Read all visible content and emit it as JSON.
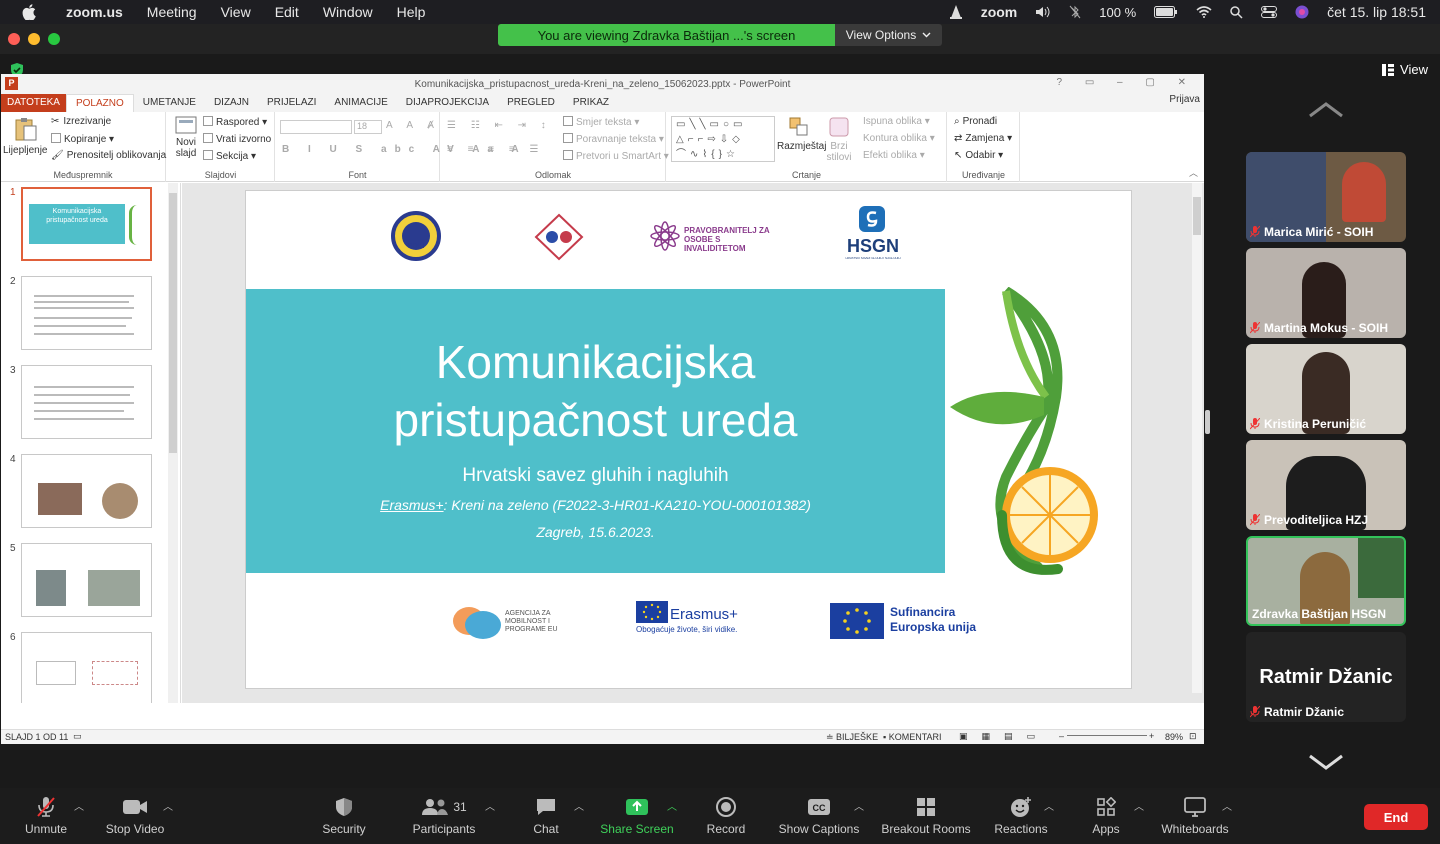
{
  "menubar": {
    "app": "zoom.us",
    "items": [
      "Meeting",
      "View",
      "Edit",
      "Window",
      "Help"
    ],
    "battery": "100 %",
    "clock": "čet 15. lip  18:51",
    "zoom_label": "zoom"
  },
  "zoom": {
    "viewing_banner": "You are viewing Zdravka Baštijan ...'s screen",
    "view_options": "View Options",
    "view_label": "View"
  },
  "ppt": {
    "title": "Komunikacijska_pristupacnost_ureda-Kreni_na_zeleno_15062023.pptx - PowerPoint",
    "tabs": [
      "DATOTEKA",
      "POLAZNO",
      "UMETANJE",
      "DIZAJN",
      "PRIJELAZI",
      "ANIMACIJE",
      "DIJAPROJEKCIJA",
      "PREGLED",
      "PRIKAZ"
    ],
    "signin": "Prijava",
    "ribbon": {
      "paste": "Lijepljenje",
      "cut": "Izrezivanje",
      "copy": "Kopiranje",
      "format_painter": "Prenositelj oblikovanja",
      "clipboard": "Međuspremnik",
      "new_slide": "Novi slajd",
      "layout": "Raspored",
      "reset": "Vrati izvorno",
      "section": "Sekcija",
      "slides": "Slajdovi",
      "font_size": "18",
      "font": "Font",
      "text_direction": "Smjer teksta",
      "align_text": "Poravnanje teksta",
      "smartart": "Pretvori u SmartArt",
      "paragraph": "Odlomak",
      "arrange": "Razmještaj",
      "quick_styles": "Brzi stilovi",
      "shape_fill": "Ispuna oblika",
      "shape_outline": "Kontura oblika",
      "shape_effects": "Efekti oblika",
      "drawing": "Crtanje",
      "find": "Pronađi",
      "replace": "Zamjena",
      "select": "Odabir",
      "editing": "Uređivanje"
    },
    "slide": {
      "title_line1": "Komunikacijska",
      "title_line2": "pristupačnost ureda",
      "subtitle": "Hrvatski savez gluhih i nagluhih",
      "project_prefix": "Erasmus+",
      "project_rest": ": Kreni na zeleno (F2022-3-HR01-KA210-YOU-000101382)",
      "date": "Zagreb, 15.6.2023.",
      "logo_soih": "SOIH",
      "logo_pravobranitelj": "PRAVOBRANITELJ ZA OSOBE S INVALIDITETOM",
      "logo_hsgn": "HSGN",
      "logo_hsgn_sub": "HRVATSKI SAVEZ GLUHIH I NAGLUHIH",
      "logo_agencija": "AGENCIJA ZA MOBILNOST I PROGRAME EU",
      "logo_erasmus": "Erasmus+",
      "logo_erasmus_sub": "Obogaćuje živote, širi vidike.",
      "logo_eu_1": "Sufinancira",
      "logo_eu_2": "Europska unija"
    },
    "thumbs": [
      "1",
      "2",
      "3",
      "4",
      "5",
      "6"
    ],
    "thumb1_title": "Komunikacijska pristupačnost ureda",
    "status": {
      "slide": "SLAJD 1 OD 11",
      "notes": "BILJEŠKE",
      "comments": "KOMENTARI",
      "zoom": "89%"
    }
  },
  "participants": [
    {
      "name": "Marica Mirić - SOIH"
    },
    {
      "name": "Martina Mokus - SOIH"
    },
    {
      "name": "Kristina Peruničić"
    },
    {
      "name": "Prevoditeljica HZJ"
    },
    {
      "name": "Zdravka Baštijan HSGN"
    },
    {
      "name": "Ratmir Džanic",
      "display": "Ratmir Džanic"
    }
  ],
  "toolbar": {
    "unmute": "Unmute",
    "stop_video": "Stop Video",
    "security": "Security",
    "participants": "Participants",
    "participants_count": "31",
    "chat": "Chat",
    "share_screen": "Share Screen",
    "record": "Record",
    "captions": "Show Captions",
    "breakout": "Breakout Rooms",
    "reactions": "Reactions",
    "apps": "Apps",
    "whiteboards": "Whiteboards",
    "end": "End"
  },
  "colors": {
    "accent_green": "#44c14a",
    "slide_teal": "#4fbfca",
    "end_red": "#e02828",
    "ppt_orange": "#c43e1c"
  }
}
